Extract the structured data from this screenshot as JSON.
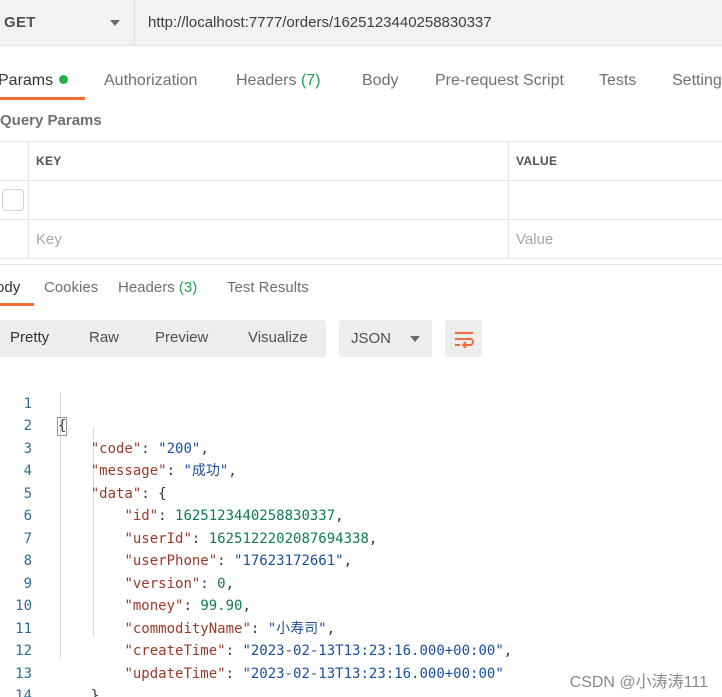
{
  "request": {
    "method": "GET",
    "url": "http://localhost:7777/orders/1625123440258830337"
  },
  "request_tabs": {
    "params": "Params",
    "authorization": "Authorization",
    "headers": "Headers",
    "headers_count": "(7)",
    "body": "Body",
    "pre_request": "Pre-request Script",
    "tests": "Tests",
    "settings": "Settings"
  },
  "query_params": {
    "title": "Query Params",
    "key_header": "KEY",
    "value_header": "VALUE",
    "key_placeholder": "Key",
    "value_placeholder": "Value"
  },
  "response_tabs": {
    "body": "Body",
    "cookies": "Cookies",
    "headers": "Headers",
    "headers_count": "(3)",
    "test_results": "Test Results"
  },
  "format_bar": {
    "pretty": "Pretty",
    "raw": "Raw",
    "preview": "Preview",
    "visualize": "Visualize",
    "language": "JSON"
  },
  "code": {
    "line_numbers": [
      "1",
      "2",
      "3",
      "4",
      "5",
      "6",
      "7",
      "8",
      "9",
      "10",
      "11",
      "12",
      "13",
      "14"
    ],
    "open": "{",
    "close": "}",
    "code_key": "\"code\"",
    "code_val": "\"200\"",
    "message_key": "\"message\"",
    "message_val": "\"成功\"",
    "data_key": "\"data\"",
    "id_key": "\"id\"",
    "id_val": "1625123440258830337",
    "userId_key": "\"userId\"",
    "userId_val": "1625122202087694338",
    "userPhone_key": "\"userPhone\"",
    "userPhone_val": "\"17623172661\"",
    "version_key": "\"version\"",
    "version_val": "0",
    "money_key": "\"money\"",
    "money_val": "99.90",
    "commodityName_key": "\"commodityName\"",
    "commodityName_val": "\"小寿司\"",
    "createTime_key": "\"createTime\"",
    "createTime_val": "\"2023-02-13T13:23:16.000+00:00\"",
    "updateTime_key": "\"updateTime\"",
    "updateTime_val": "\"2023-02-13T13:23:16.000+00:00\""
  },
  "watermark": "CSDN @小涛涛111",
  "colors": {
    "accent": "#f26b3a",
    "count_green": "#21a354",
    "json_key": "#9b3a27",
    "json_string": "#1a4fa0",
    "json_number": "#107a52"
  }
}
